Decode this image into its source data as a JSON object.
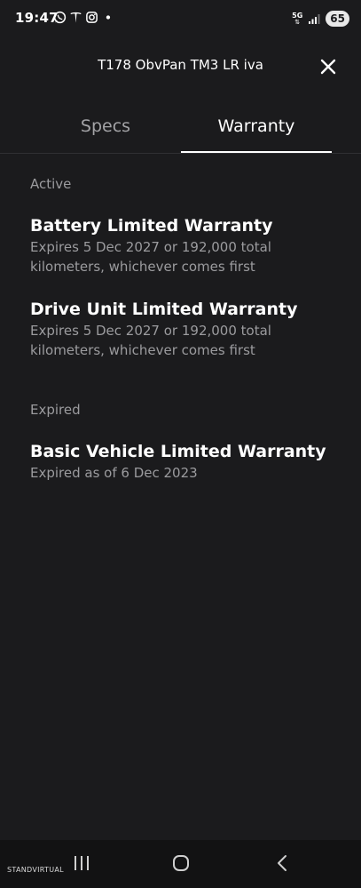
{
  "status_bar": {
    "time": "19:47",
    "network": "5G",
    "battery": "65",
    "icons": [
      "whatsapp-icon",
      "tesla-icon",
      "instagram-icon",
      "dot-icon",
      "signal-icon"
    ]
  },
  "header": {
    "title": "T178 ObvPan TM3 LR iva",
    "close_icon": "close-icon"
  },
  "tabs": [
    {
      "label": "Specs",
      "active": false
    },
    {
      "label": "Warranty",
      "active": true
    }
  ],
  "sections": {
    "active": {
      "label": "Active",
      "items": [
        {
          "title": "Battery Limited Warranty",
          "description": "Expires 5 Dec 2027 or 192,000 total kilometers, whichever comes first"
        },
        {
          "title": "Drive Unit Limited Warranty",
          "description": "Expires 5 Dec 2027 or 192,000 total kilometers, whichever comes first"
        }
      ]
    },
    "expired": {
      "label": "Expired",
      "items": [
        {
          "title": "Basic Vehicle Limited Warranty",
          "description": "Expired as of 6 Dec 2023"
        }
      ]
    }
  },
  "nav_bar": {
    "icons": [
      "recent-apps-icon",
      "home-icon",
      "back-icon"
    ]
  },
  "watermark": "STANDVIRTUAL"
}
